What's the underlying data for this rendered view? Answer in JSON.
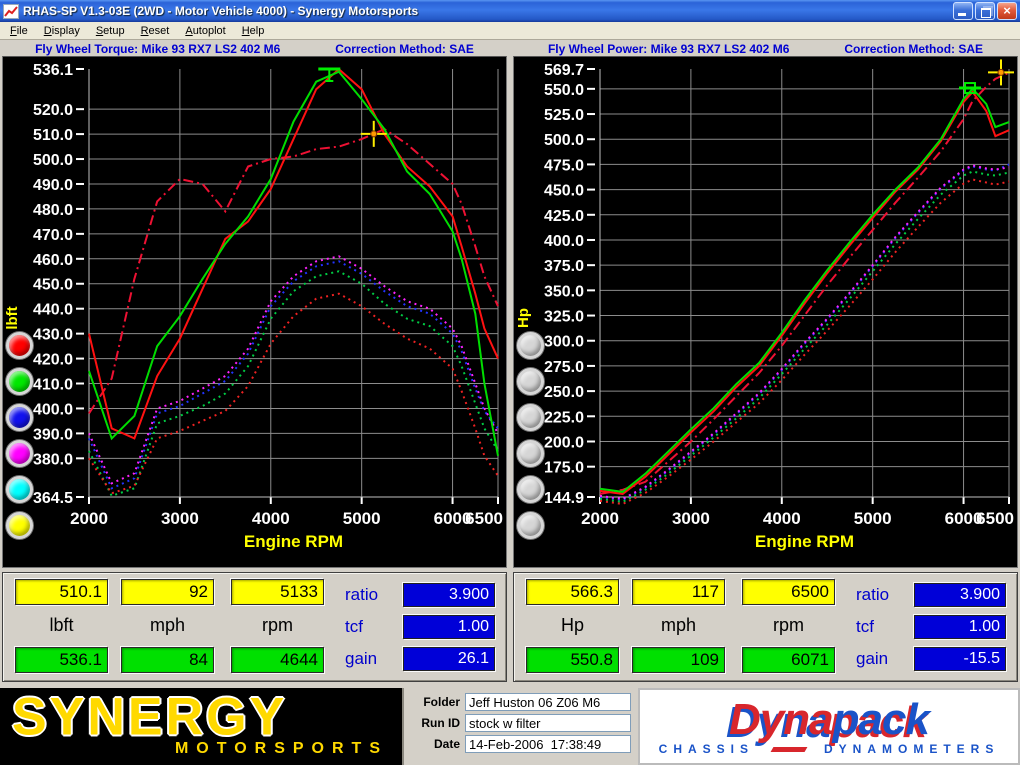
{
  "window": {
    "title": "RHAS-SP V1.3-03E  (2WD - Motor Vehicle 4000) - Synergy Motorsports"
  },
  "menu": {
    "items": [
      "File",
      "Display",
      "Setup",
      "Reset",
      "Autoplot",
      "Help"
    ]
  },
  "chart_data": [
    {
      "type": "line",
      "title": "Fly Wheel Torque: Mike 93 RX7 LS2 402 M6",
      "correction": "Correction Method: SAE",
      "xlabel": "Engine RPM",
      "ylabel": "lbft",
      "xlim": [
        2000,
        6500
      ],
      "ylim": [
        364.5,
        536.1
      ],
      "xticks": [
        2000,
        3000,
        4000,
        5000,
        6000,
        6500
      ],
      "yticks": [
        536.1,
        520,
        510,
        500,
        490,
        480,
        470,
        460,
        450,
        440,
        430,
        420,
        410,
        400,
        390,
        380,
        364.5
      ],
      "ytick_labels": [
        "536.1",
        "520.0",
        "510.0",
        "500.0",
        "490.0",
        "480.0",
        "470.0",
        "460.0",
        "450.0",
        "440.0",
        "430.0",
        "420.0",
        "410.0",
        "400.0",
        "390.0",
        "380.0",
        "364.5"
      ],
      "x": [
        2000,
        2250,
        2500,
        2750,
        3000,
        3250,
        3500,
        3750,
        4000,
        4250,
        4500,
        4750,
        5000,
        5250,
        5500,
        5750,
        6000,
        6100,
        6250,
        6350,
        6500
      ],
      "series": [
        {
          "name": "run-blue-dot-torque",
          "color": "#2233ff",
          "style": "dot",
          "values": [
            388,
            368,
            372,
            398,
            401,
            406,
            411,
            422,
            441,
            451,
            457,
            459,
            454,
            447,
            441,
            438,
            430,
            423,
            408,
            399,
            392
          ]
        },
        {
          "name": "run-magenta-dot-torque",
          "color": "#ff22ff",
          "style": "dot",
          "values": [
            390,
            370,
            374,
            400,
            403,
            408,
            413,
            424,
            443,
            453,
            459,
            461,
            456,
            449,
            443,
            440,
            432,
            425,
            410,
            400,
            390
          ]
        },
        {
          "name": "run-green-dot-torque",
          "color": "#00cc44",
          "style": "dot",
          "values": [
            383,
            365,
            368,
            394,
            397,
            401,
            406,
            417,
            436,
            447,
            453,
            455,
            450,
            442,
            436,
            433,
            425,
            417,
            402,
            392,
            383
          ]
        },
        {
          "name": "run-red-dot-torque",
          "color": "#ee2222",
          "style": "dot",
          "values": [
            380,
            366,
            369,
            388,
            391,
            395,
            399,
            409,
            426,
            437,
            444,
            446,
            441,
            434,
            428,
            424,
            416,
            407,
            392,
            381,
            373
          ]
        },
        {
          "name": "run-compare-dash-torque",
          "color": "#ee1133",
          "style": "dashdot",
          "values": [
            398,
            412,
            452,
            483,
            492,
            490,
            479,
            497,
            500,
            501,
            504,
            505,
            508,
            512,
            506,
            498,
            490,
            482,
            465,
            453,
            441
          ]
        },
        {
          "name": "run-red-solid-torque",
          "color": "#ff1111",
          "style": "solid",
          "values": [
            430,
            392,
            388,
            413,
            428,
            448,
            468,
            475,
            488,
            508,
            528,
            536,
            528,
            510,
            497,
            489,
            477,
            465,
            446,
            432,
            420
          ]
        },
        {
          "name": "run-green-solid-torque",
          "color": "#00dd00",
          "style": "solid",
          "values": [
            415,
            388,
            397,
            425,
            437,
            452,
            466,
            477,
            492,
            515,
            531,
            535,
            524,
            512,
            495,
            486,
            471,
            460,
            438,
            410,
            381
          ]
        }
      ],
      "cursor": {
        "x": 5133,
        "y": 510.1
      },
      "marker": {
        "x": 4644,
        "y": 536.1,
        "shape": "tbar"
      },
      "buttons": [
        "#ff0000",
        "#00e800",
        "#1111ee",
        "#ff00ff",
        "#00ffff",
        "#ffff00"
      ]
    },
    {
      "type": "line",
      "title": "Fly Wheel Power: Mike 93 RX7 LS2 402 M6",
      "correction": "Correction Method: SAE",
      "xlabel": "Engine RPM",
      "ylabel": "Hp",
      "xlim": [
        2000,
        6500
      ],
      "ylim": [
        144.9,
        569.7
      ],
      "xticks": [
        2000,
        3000,
        4000,
        5000,
        6000,
        6500
      ],
      "yticks": [
        569.7,
        550,
        525,
        500,
        475,
        450,
        425,
        400,
        375,
        350,
        325,
        300,
        275,
        250,
        225,
        200,
        175,
        144.9
      ],
      "ytick_labels": [
        "569.7",
        "550.0",
        "525.0",
        "500.0",
        "475.0",
        "450.0",
        "425.0",
        "400.0",
        "375.0",
        "350.0",
        "325.0",
        "300.0",
        "275.0",
        "250.0",
        "225.0",
        "200.0",
        "175.0",
        "144.9"
      ],
      "x": [
        2000,
        2250,
        2500,
        2750,
        3000,
        3250,
        3500,
        3750,
        4000,
        4250,
        4500,
        4750,
        5000,
        5250,
        5500,
        5750,
        6000,
        6100,
        6250,
        6350,
        6500
      ],
      "series": [
        {
          "name": "run-blue-dot-power",
          "color": "#2233ff",
          "style": "dot",
          "values": [
            145,
            142,
            154,
            171,
            189,
            207,
            227,
            247,
            271,
            297,
            321,
            347,
            374,
            402,
            427,
            451,
            469,
            473,
            470,
            469,
            475
          ]
        },
        {
          "name": "run-magenta-dot-power",
          "color": "#ff22ff",
          "style": "dot",
          "values": [
            146,
            143,
            155,
            172,
            190,
            208,
            228,
            248,
            272,
            298,
            322,
            348,
            375,
            403,
            428,
            452,
            470,
            474,
            471,
            470,
            472
          ]
        },
        {
          "name": "run-green-dot-power",
          "color": "#00cc44",
          "style": "dot",
          "values": [
            143,
            140,
            152,
            168,
            186,
            204,
            223,
            243,
            267,
            292,
            316,
            342,
            369,
            396,
            421,
            445,
            464,
            468,
            465,
            464,
            467
          ]
        },
        {
          "name": "run-red-dot-power",
          "color": "#ee2222",
          "style": "dot",
          "values": [
            141,
            138,
            149,
            165,
            182,
            200,
            219,
            238,
            261,
            286,
            310,
            335,
            361,
            388,
            413,
            437,
            456,
            460,
            457,
            455,
            458
          ]
        },
        {
          "name": "run-compare-dash-power",
          "color": "#ee1133",
          "style": "dashdot",
          "values": [
            148,
            152,
            160,
            180,
            200,
            222,
            245,
            268,
            295,
            325,
            355,
            383,
            410,
            437,
            462,
            488,
            520,
            538,
            552,
            560,
            566
          ]
        },
        {
          "name": "run-red-solid-power",
          "color": "#ff1111",
          "style": "solid",
          "values": [
            151,
            148,
            165,
            187,
            209,
            230,
            254,
            275,
            305,
            337,
            367,
            395,
            422,
            448,
            470,
            498,
            537,
            547,
            528,
            503,
            509
          ]
        },
        {
          "name": "run-green-solid-power",
          "color": "#00dd00",
          "style": "solid",
          "values": [
            153,
            150,
            168,
            190,
            212,
            233,
            257,
            278,
            308,
            340,
            370,
            398,
            425,
            450,
            472,
            500,
            540,
            550,
            535,
            512,
            517
          ]
        }
      ],
      "cursor": {
        "x": 6500,
        "y": 566.3
      },
      "marker": {
        "x": 6071,
        "y": 550.8,
        "shape": "square"
      },
      "buttons": [
        "#d6d6d6",
        "#d6d6d6",
        "#d6d6d6",
        "#d6d6d6",
        "#d6d6d6",
        "#d6d6d6"
      ]
    }
  ],
  "panels": [
    {
      "top_values": [
        "510.1",
        "92",
        "5133"
      ],
      "labels": [
        "lbft",
        "mph",
        "rpm"
      ],
      "bottom_values": [
        "536.1",
        "84",
        "4644"
      ],
      "side_labels": [
        "ratio",
        "tcf",
        "gain"
      ],
      "side_values": [
        "3.900",
        "1.00",
        "26.1"
      ]
    },
    {
      "top_values": [
        "566.3",
        "117",
        "6500"
      ],
      "labels": [
        "Hp",
        "mph",
        "rpm"
      ],
      "bottom_values": [
        "550.8",
        "109",
        "6071"
      ],
      "side_labels": [
        "ratio",
        "tcf",
        "gain"
      ],
      "side_values": [
        "3.900",
        "1.00",
        "-15.5"
      ]
    }
  ],
  "footer": {
    "brand": {
      "name": "SYNERGY",
      "sub": "MOTORSPORTS"
    },
    "fields": [
      {
        "label": "Folder",
        "value": "Jeff Huston 06 Z06 M6"
      },
      {
        "label": "Run ID",
        "value": "stock w filter"
      },
      {
        "label": "Date",
        "value": "14-Feb-2006  17:38:49"
      }
    ],
    "dynapack": {
      "word1": "Dyna",
      "word2": "pack",
      "sub1": "CHASSIS",
      "sub2": "DYNAMOMETERS"
    }
  },
  "colors": {
    "accent_blue": "#0000cc",
    "value_yellow": "#ffff00",
    "value_green": "#00e000",
    "value_blue": "#0000d8",
    "chart_grid": "#8c8c8c"
  }
}
